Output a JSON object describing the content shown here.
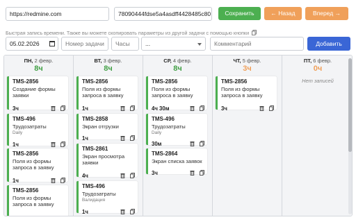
{
  "top": {
    "url": "https://redmine.com",
    "api_key": "78090444fdse5a4asdff4428485c80",
    "save_label": "Сохранить",
    "back_label": "← Назад",
    "forward_label": "Вперед →"
  },
  "hint": "Быстрая запись времени. Также вы можете скопировать параметры из другой задачи с помощью кнопки",
  "form": {
    "date": "05.02.2026",
    "task_placeholder": "Номер задачи",
    "hours_placeholder": "Часы",
    "activity_value": "...",
    "comment_placeholder": "Комментарий",
    "add_label": "Добавить"
  },
  "days": [
    {
      "abbr": "ПН,",
      "date": "2 февр.",
      "hours": "8ч",
      "status": "green",
      "entries": [
        {
          "key": "TMS-2856",
          "title": "Создание формы заявки",
          "tag": "",
          "time": "3ч"
        },
        {
          "key": "TMS-496",
          "title": "Трудозатраты",
          "tag": "Daily",
          "time": "1ч"
        },
        {
          "key": "TMS-2856",
          "title": "Поля из формы запроса в заявку",
          "tag": "",
          "time": "1ч"
        },
        {
          "key": "TMS-2856",
          "title": "Поля из формы запроса в заявку",
          "tag": "",
          "time": ""
        }
      ]
    },
    {
      "abbr": "ВТ,",
      "date": "3 февр.",
      "hours": "8ч",
      "status": "green",
      "entries": [
        {
          "key": "TMS-2856",
          "title": "Поля из формы запроса в заявку",
          "tag": "",
          "time": "1ч"
        },
        {
          "key": "TMS-2858",
          "title": "Экран отгрузки",
          "tag": "",
          "time": "1ч"
        },
        {
          "key": "TMS-2861",
          "title": "Экран просмотра заявки",
          "tag": "",
          "time": "4ч"
        },
        {
          "key": "TMS-496",
          "title": "Трудозатраты",
          "tag": "Валидация",
          "time": "1ч"
        }
      ]
    },
    {
      "abbr": "СР,",
      "date": "4 февр.",
      "hours": "8ч",
      "status": "green",
      "entries": [
        {
          "key": "TMS-2856",
          "title": "Поля из формы запроса в заявку",
          "tag": "",
          "time": "4ч 30м"
        },
        {
          "key": "TMS-496",
          "title": "Трудозатраты",
          "tag": "Daily",
          "time": "30м"
        },
        {
          "key": "TMS-2864",
          "title": "Экран списка заявок",
          "tag": "",
          "time": "3ч"
        }
      ]
    },
    {
      "abbr": "ЧТ,",
      "date": "5 февр.",
      "hours": "3ч",
      "status": "orange",
      "entries": [
        {
          "key": "TMS-2856",
          "title": "Поля из формы запроса в заявку",
          "tag": "",
          "time": "3ч"
        }
      ]
    },
    {
      "abbr": "ПТ,",
      "date": "6 февр.",
      "hours": "0ч",
      "status": "orange",
      "empty_text": "Нет записей",
      "entries": []
    }
  ],
  "colors": {
    "green": "#4caf50",
    "orange": "#f0a05a",
    "blue": "#3a66d6"
  },
  "icons": {
    "delete": "trash-icon",
    "copy": "copy-icon"
  }
}
